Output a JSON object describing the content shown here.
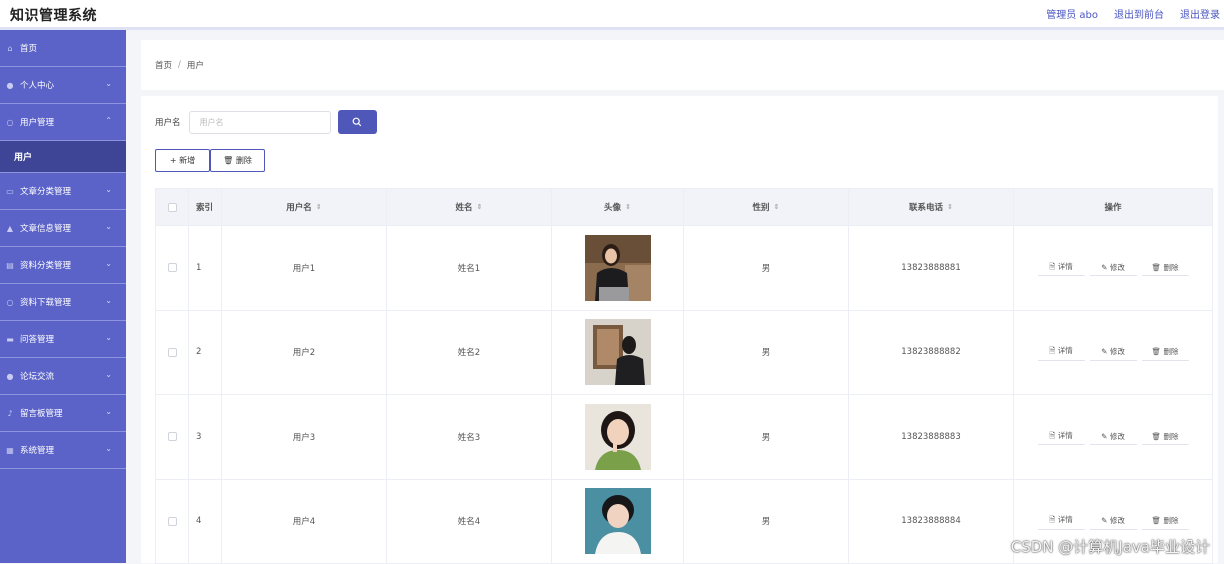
{
  "header": {
    "title": "知识管理系统",
    "admin_label": "管理员 abo",
    "back_front": "退出到前台",
    "logout": "退出登录"
  },
  "sidebar": {
    "items": [
      {
        "label": "首页",
        "icon": "home-icon",
        "chevron": ""
      },
      {
        "label": "个人中心",
        "icon": "user-icon",
        "chevron": "⌄"
      },
      {
        "label": "用户管理",
        "icon": "circle-icon",
        "chevron": "⌃"
      },
      {
        "label": "文章分类管理",
        "icon": "folder-icon",
        "chevron": "⌄"
      },
      {
        "label": "文章信息管理",
        "icon": "thumb-icon",
        "chevron": "⌄"
      },
      {
        "label": "资料分类管理",
        "icon": "bank-icon",
        "chevron": "⌄"
      },
      {
        "label": "资料下载管理",
        "icon": "circle-icon",
        "chevron": "⌄"
      },
      {
        "label": "问答管理",
        "icon": "message-icon",
        "chevron": "⌄"
      },
      {
        "label": "论坛交流",
        "icon": "user-icon",
        "chevron": "⌄"
      },
      {
        "label": "留言板管理",
        "icon": "mic-icon",
        "chevron": "⌄"
      },
      {
        "label": "系统管理",
        "icon": "grid-icon",
        "chevron": "⌄"
      }
    ],
    "submenu_active": "用户"
  },
  "breadcrumb": {
    "home": "首页",
    "sep": "/",
    "current": "用户"
  },
  "search": {
    "label": "用户名",
    "placeholder": "用户名"
  },
  "buttons": {
    "add": "+ 新增",
    "delete": "🗑 删除"
  },
  "table": {
    "headers": {
      "index": "索引",
      "username": "用户名",
      "name": "姓名",
      "avatar": "头像",
      "gender": "性别",
      "phone": "联系电话",
      "actions": "操作"
    },
    "sort_icon": "⇕",
    "rows": [
      {
        "index": "1",
        "username": "用户1",
        "name": "姓名1",
        "gender": "男",
        "phone": "13823888881"
      },
      {
        "index": "2",
        "username": "用户2",
        "name": "姓名2",
        "gender": "男",
        "phone": "13823888882"
      },
      {
        "index": "3",
        "username": "用户3",
        "name": "姓名3",
        "gender": "男",
        "phone": "13823888883"
      },
      {
        "index": "4",
        "username": "用户4",
        "name": "姓名4",
        "gender": "男",
        "phone": "13823888884"
      }
    ],
    "actions": {
      "detail": "🗎 详情",
      "edit": "✎ 修改",
      "delete": "🗑 删除"
    }
  },
  "watermark": "CSDN @计算机Java毕业设计",
  "colors": {
    "sidebar": "#5b63c9",
    "sidebar_active": "#3e4597",
    "accent": "#4f58b8"
  }
}
